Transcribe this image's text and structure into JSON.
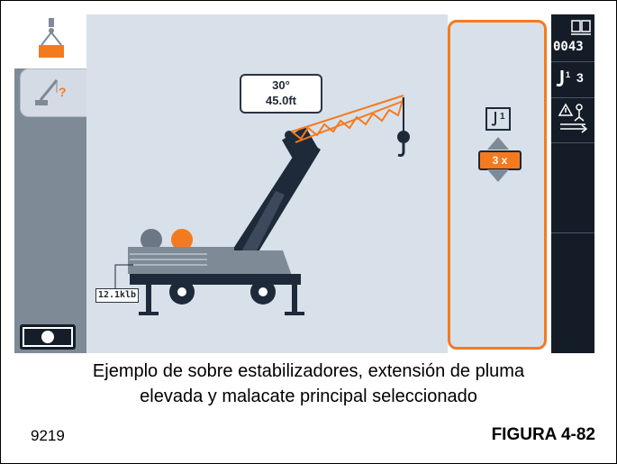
{
  "display": {
    "boom_angle": "30°",
    "boom_length": "45.0ft",
    "outrigger_load": "12.1klb",
    "reeving": "3 x",
    "counter": "0043",
    "active_hoist_number": "3"
  },
  "caption": {
    "line1": "Ejemplo de sobre estabilizadores, extensión de pluma",
    "line2": "elevada y malacate principal seleccionado",
    "code": "9219",
    "figure": "FIGURA 4-82"
  },
  "colors": {
    "accent": "#f47a20",
    "dark": "#141c27",
    "panel": "#d8e1ea",
    "crane_body": "#1e2a3a"
  },
  "icons": {
    "tab_crane": "crane-hook-icon",
    "tab_help": "crane-question-icon",
    "hook_select": "hook-block-icon",
    "counter": "counter-icon",
    "hoist": "hoist-hook-icon",
    "warning": "warning-icon",
    "camera": "camera-icon"
  }
}
